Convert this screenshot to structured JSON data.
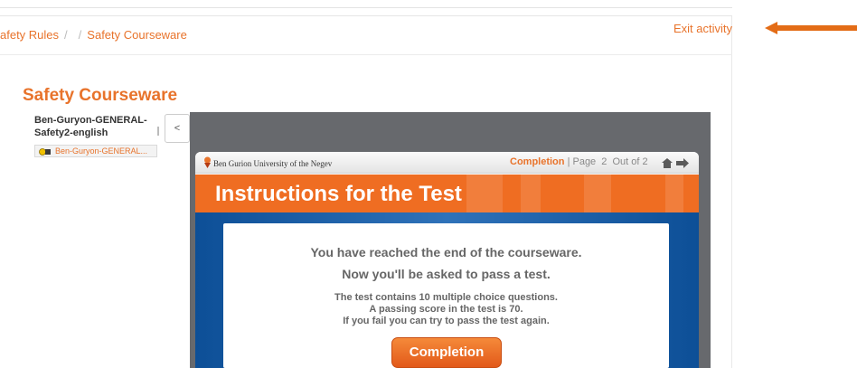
{
  "breadcrumb": {
    "item1": "afety Rules",
    "item2": "Safety Courseware"
  },
  "header": {
    "exit_label": "Exit activity"
  },
  "page": {
    "title": "Safety Courseware"
  },
  "toc": {
    "title": "Ben-Guryon-GENERAL-Safety2-english",
    "item_label": "Ben-Guryon-GENERAL...",
    "toggle_label": "<"
  },
  "course": {
    "university": "Ben Gurion University of the Negev",
    "status_label": "Completion",
    "page_label": "Page",
    "page_current": "2",
    "page_total_label": "Out of 2",
    "banner_title": "Instructions for the Test",
    "line1": "You have reached the end of the courseware.",
    "line2": "Now you'll be asked to pass a test.",
    "rules": [
      "The test contains 10 multiple choice questions.",
      "A passing score in the test is 70.",
      "If you fail you can try to pass the test again."
    ],
    "completion_button": "Completion"
  },
  "colors": {
    "accent": "#e8732b",
    "banner": "#ef6d22",
    "blue": "#0d4f97",
    "player_bg": "#67696d"
  }
}
